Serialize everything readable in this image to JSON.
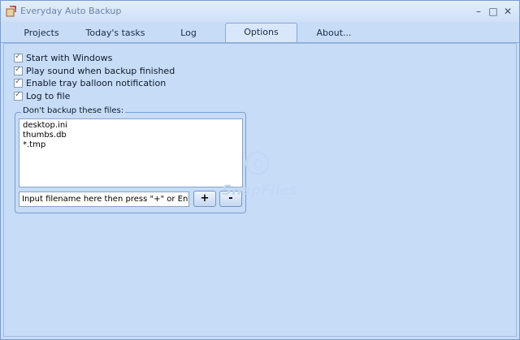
{
  "window": {
    "title": "Everyday Auto Backup",
    "controls": [
      "–",
      "□",
      "✕"
    ]
  },
  "tabs": [
    {
      "label": "Projects",
      "active": false
    },
    {
      "label": "Today's tasks",
      "active": false
    },
    {
      "label": "Log",
      "active": false
    },
    {
      "label": "Options",
      "active": true
    },
    {
      "label": "About...",
      "active": false
    }
  ],
  "options": {
    "checkboxes": [
      {
        "label": "Start with Windows",
        "checked": true
      },
      {
        "label": "Play sound when backup finished",
        "checked": true
      },
      {
        "label": "Enable tray balloon notification",
        "checked": true
      },
      {
        "label": "Log to file",
        "checked": true
      }
    ],
    "exclude_group": {
      "label": "Don't backup these files:",
      "files": [
        "desktop.ini",
        "thumbs.db",
        "*.tmp"
      ],
      "input_value": "Input filename here then press \"+\" or Enter",
      "add_label": "+",
      "remove_label": "-"
    }
  },
  "watermark": {
    "text": "SnapFiles",
    "symbol": "©"
  },
  "colors": {
    "background": "#c7dcf7",
    "tab_active": "#d8e7fb",
    "border": "#8aa9d6"
  }
}
